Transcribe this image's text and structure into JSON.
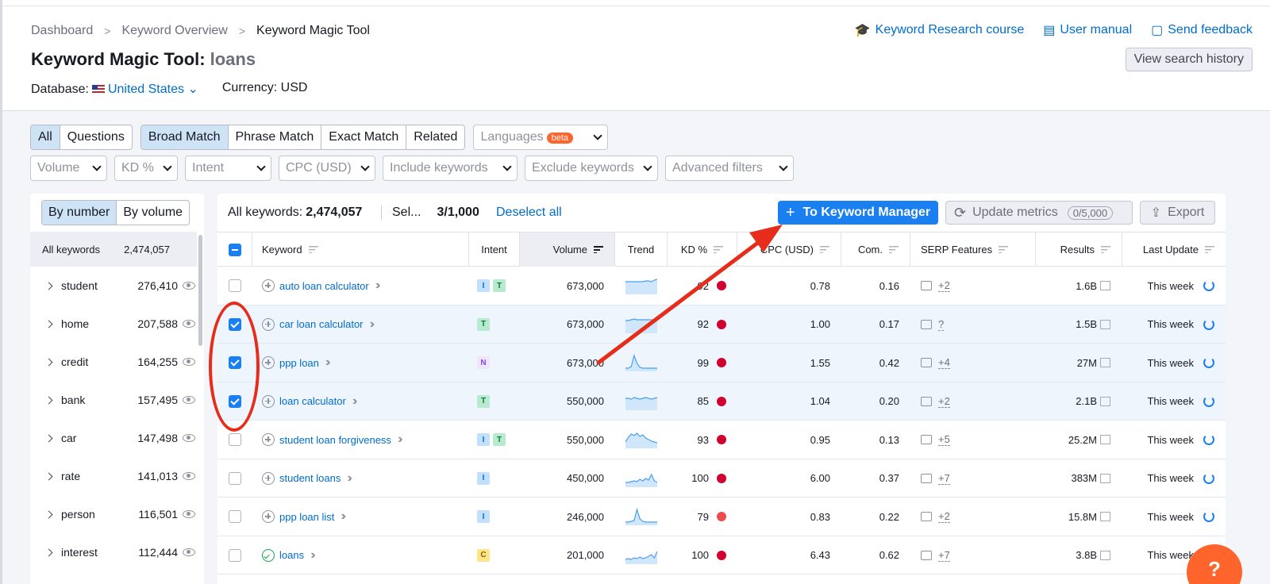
{
  "breadcrumb": [
    "Dashboard",
    "Keyword Overview",
    "Keyword Magic Tool"
  ],
  "header_links": [
    "Keyword Research course",
    "User manual",
    "Send feedback"
  ],
  "title": "Keyword Magic Tool:",
  "query": "loans",
  "view_history": "View search history",
  "database_label": "Database:",
  "database_value": "United States",
  "currency": "Currency: USD",
  "question_tabs": [
    "All",
    "Questions"
  ],
  "match_tabs": [
    "Broad Match",
    "Phrase Match",
    "Exact Match",
    "Related"
  ],
  "languages": {
    "label": "Languages",
    "badge": "beta"
  },
  "filters": [
    "Volume",
    "KD %",
    "Intent",
    "CPC (USD)",
    "Include keywords",
    "Exclude keywords",
    "Advanced filters"
  ],
  "sidebar": {
    "toggle": [
      "By number",
      "By volume"
    ],
    "all_label": "All keywords",
    "all_count": "2,474,057",
    "items": [
      {
        "name": "student",
        "count": "276,410"
      },
      {
        "name": "home",
        "count": "207,588"
      },
      {
        "name": "credit",
        "count": "164,255"
      },
      {
        "name": "bank",
        "count": "157,495"
      },
      {
        "name": "car",
        "count": "147,498"
      },
      {
        "name": "rate",
        "count": "141,013"
      },
      {
        "name": "person",
        "count": "116,501"
      },
      {
        "name": "interest",
        "count": "112,444"
      }
    ]
  },
  "toolbar": {
    "all_label": "All keywords:",
    "all_count": "2,474,057",
    "sel_label": "Sel...",
    "sel_count": "3/1,000",
    "deselect": "Deselect all",
    "to_manager": "To Keyword Manager",
    "update": "Update metrics",
    "update_count": "0/5,000",
    "export": "Export"
  },
  "columns": [
    "Keyword",
    "Intent",
    "Volume",
    "Trend",
    "KD %",
    "CPC (USD)",
    "Com.",
    "SERP Features",
    "Results",
    "Last Update"
  ],
  "rows": [
    {
      "keyword": "auto loan calculator",
      "intent": [
        "I",
        "T"
      ],
      "volume": "673,000",
      "kd": "92",
      "kd_color": "#d1002f",
      "cpc": "0.78",
      "com": "0.16",
      "serp": "+2",
      "results": "1.6B",
      "update": "This week",
      "checked": false,
      "trend": [
        6,
        6,
        6,
        6,
        6,
        6,
        6,
        5,
        5,
        6,
        4,
        3
      ]
    },
    {
      "keyword": "car loan calculator",
      "intent": [
        "T"
      ],
      "volume": "673,000",
      "kd": "92",
      "kd_color": "#d1002f",
      "cpc": "1.00",
      "com": "0.17",
      "serp": "?",
      "results": "1.5B",
      "update": "This week",
      "checked": true,
      "trend": [
        6,
        6,
        5,
        4,
        5,
        5,
        5,
        5,
        5,
        5,
        5,
        5
      ]
    },
    {
      "keyword": "ppp loan",
      "intent": [
        "N"
      ],
      "volume": "673,000",
      "kd": "99",
      "kd_color": "#d1002f",
      "cpc": "1.55",
      "com": "0.42",
      "serp": "+4",
      "results": "27M",
      "update": "This week",
      "checked": true,
      "trend": [
        18,
        18,
        16,
        2,
        12,
        17,
        18,
        18,
        18,
        18,
        18,
        18
      ]
    },
    {
      "keyword": "loan calculator",
      "intent": [
        "T"
      ],
      "volume": "550,000",
      "kd": "85",
      "kd_color": "#d1002f",
      "cpc": "1.04",
      "com": "0.20",
      "serp": "+2",
      "results": "2.1B",
      "update": "This week",
      "checked": true,
      "trend": [
        7,
        7,
        8,
        6,
        7,
        8,
        7,
        6,
        7,
        8,
        7,
        6
      ]
    },
    {
      "keyword": "student loan forgiveness",
      "intent": [
        "I",
        "T"
      ],
      "volume": "550,000",
      "kd": "93",
      "kd_color": "#d1002f",
      "cpc": "0.95",
      "com": "0.13",
      "serp": "+5",
      "results": "25.2M",
      "update": "This week",
      "checked": false,
      "trend": [
        14,
        8,
        4,
        6,
        3,
        7,
        5,
        9,
        11,
        13,
        14,
        15
      ]
    },
    {
      "keyword": "student loans",
      "intent": [
        "I"
      ],
      "volume": "450,000",
      "kd": "100",
      "kd_color": "#d1002f",
      "cpc": "6.00",
      "com": "0.37",
      "serp": "+7",
      "results": "383M",
      "update": "This week",
      "checked": false,
      "trend": [
        16,
        16,
        15,
        14,
        15,
        12,
        14,
        11,
        13,
        6,
        14,
        16
      ]
    },
    {
      "keyword": "ppp loan list",
      "intent": [
        "I"
      ],
      "volume": "246,000",
      "kd": "79",
      "kd_color": "#eb4d4d",
      "cpc": "0.83",
      "com": "0.22",
      "serp": "+2",
      "results": "15.8M",
      "update": "This week",
      "checked": false,
      "trend": [
        18,
        18,
        17,
        16,
        2,
        14,
        17,
        18,
        18,
        18,
        18,
        18
      ]
    },
    {
      "keyword": "loans",
      "intent": [
        "C"
      ],
      "volume": "201,000",
      "kd": "100",
      "kd_color": "#d1002f",
      "cpc": "6.43",
      "com": "0.62",
      "serp": "+7",
      "results": "3.8B",
      "update": "This week",
      "checked": false,
      "trend": [
        16,
        15,
        16,
        14,
        15,
        13,
        15,
        14,
        12,
        10,
        14,
        6
      ],
      "added": true
    }
  ],
  "help": "?"
}
